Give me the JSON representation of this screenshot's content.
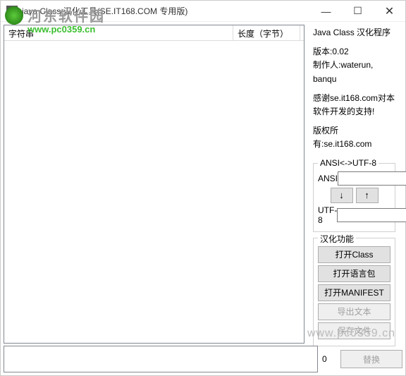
{
  "window": {
    "title": "java Class 汉化工具(SE.IT168.COM 专用版)"
  },
  "table": {
    "col1": "字符串",
    "col2": "长度（字节）"
  },
  "info": {
    "title": "Java Class 汉化程序",
    "version_label": "版本:0.02",
    "author": "制作人:waterun, banqu",
    "thanks": "感谢se.it168.com对本软件开发的支持!",
    "copyright": "版权所有:se.it168.com"
  },
  "ansi_group": {
    "title": "ANSI<->UTF-8",
    "label_ansi": "ANSI",
    "label_utf8": "UTF-8",
    "down": "↓",
    "up": "↑"
  },
  "func_group": {
    "title": "汉化功能",
    "open_class": "打开Class",
    "open_lang": "打开语言包",
    "open_manifest": "打开MANIFEST",
    "export_text": "导出文本",
    "save_file": "保存文件"
  },
  "bottom": {
    "count": "0",
    "replace": "替换"
  },
  "watermark": {
    "text": "河东软件园",
    "url": "www.pc0359.cn"
  }
}
